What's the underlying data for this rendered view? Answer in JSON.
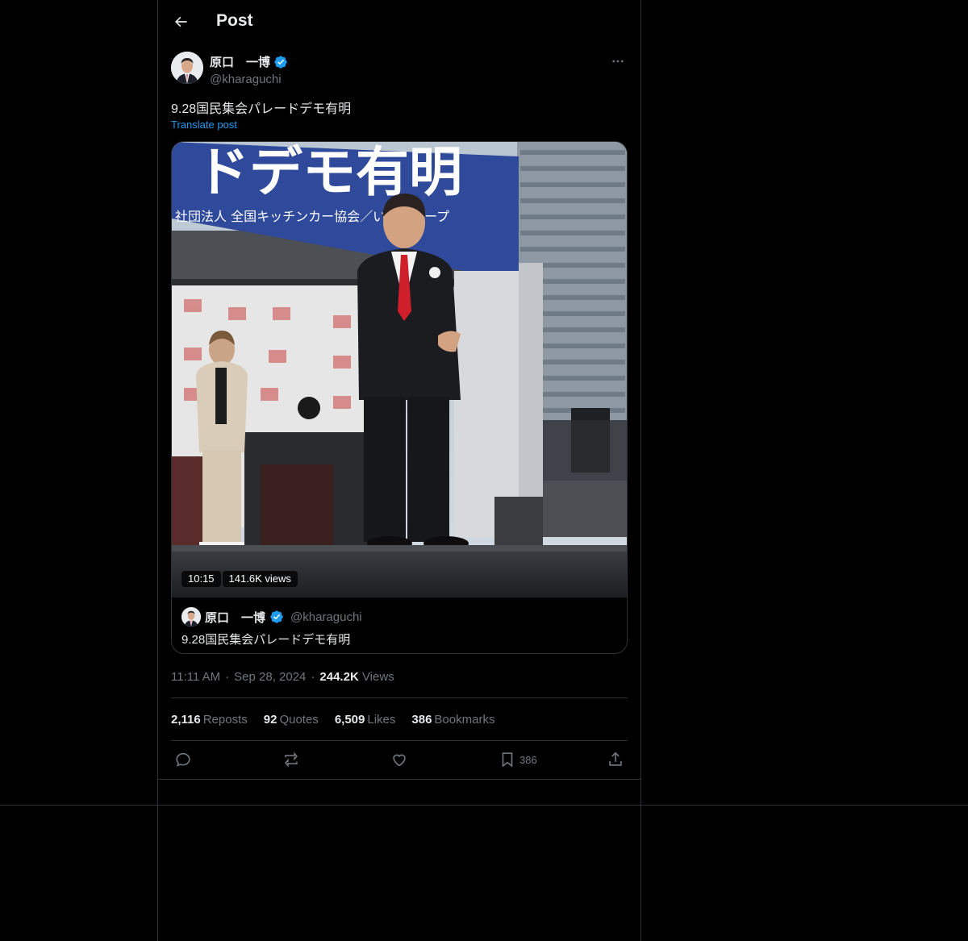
{
  "header": {
    "title": "Post"
  },
  "post": {
    "author_name": "原口　一博",
    "author_handle": "@kharaguchi",
    "text": "9.28国民集会パレードデモ有明",
    "translate_label": "Translate post",
    "video": {
      "duration": "10:15",
      "views": "141.6K views",
      "banner_text": "ドデモ有明",
      "banner_subtext": "社団法人 全国キッチンカー協会／いなグループ"
    },
    "quoted": {
      "author_name": "原口　一博",
      "author_handle": "@kharaguchi",
      "text": "9.28国民集会パレードデモ有明"
    },
    "time": "11:11 AM",
    "date": "Sep 28, 2024",
    "views_count": "244.2K",
    "views_label": "Views",
    "stats": {
      "reposts_count": "2,116",
      "reposts_label": "Reposts",
      "quotes_count": "92",
      "quotes_label": "Quotes",
      "likes_count": "6,509",
      "likes_label": "Likes",
      "bookmarks_count": "386",
      "bookmarks_label": "Bookmarks"
    },
    "actions": {
      "bookmark_count": "386"
    }
  },
  "colors": {
    "background": "#000000",
    "accent": "#1d9bf0",
    "border": "#2f3336",
    "muted": "#71767b",
    "text": "#e7e9ea"
  }
}
